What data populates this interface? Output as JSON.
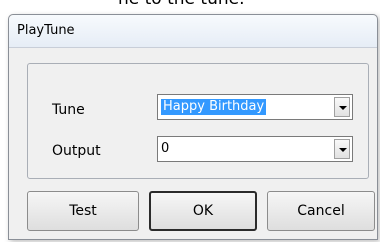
{
  "background_caption": "ne to the tune.",
  "dialog": {
    "title": "PlayTune",
    "fields": [
      {
        "label": "Tune",
        "value": "Happy Birthday",
        "selected": true
      },
      {
        "label": "Output",
        "value": "0",
        "selected": false
      }
    ],
    "buttons": {
      "test": "Test",
      "ok": "OK",
      "cancel": "Cancel"
    }
  },
  "colors": {
    "selection_highlight": "#3399ff",
    "dialog_background": "#f0f0f0"
  }
}
